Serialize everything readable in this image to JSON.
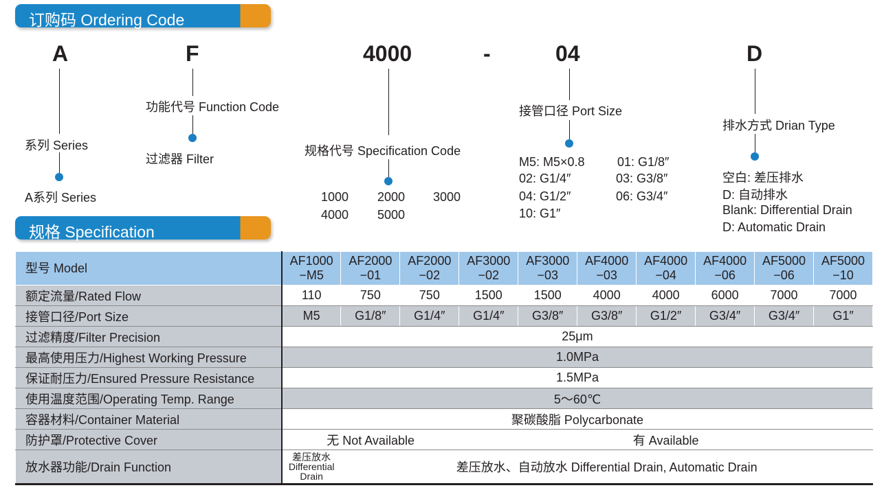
{
  "banners": {
    "ordering": "订购码 Ordering Code",
    "spec": "规格 Specification"
  },
  "code": {
    "letters": [
      "A",
      "F",
      "4000",
      "-",
      "04",
      "D"
    ],
    "series_label": "系列  Series",
    "series_value": "A系列 Series",
    "function_label": "功能代号 Function Code",
    "function_value": "过滤器   Filter",
    "spec_label": "规格代号 Specification Code",
    "spec_values": [
      "1000",
      "2000",
      "3000",
      "4000",
      "5000"
    ],
    "port_label": "接管口径 Port Size",
    "port_values": [
      "M5: M5×0.8",
      "01: G1/8″",
      "02: G1/4″",
      "03: G3/8″",
      "04: G1/2″",
      "06: G3/4″",
      "10: G1″"
    ],
    "drain_label": "排水方式 Drian Type",
    "drain_values": [
      "空白: 差压排水",
      "D: 自动排水",
      "Blank: Differential Drain",
      "D: Automatic Drain"
    ]
  },
  "table": {
    "model_header": "型号 Model",
    "models": [
      [
        "AF1000",
        "−M5"
      ],
      [
        "AF2000",
        "−01"
      ],
      [
        "AF2000",
        "−02"
      ],
      [
        "AF3000",
        "−02"
      ],
      [
        "AF3000",
        "−03"
      ],
      [
        "AF4000",
        "−03"
      ],
      [
        "AF4000",
        "−04"
      ],
      [
        "AF4000",
        "−06"
      ],
      [
        "AF5000",
        "−06"
      ],
      [
        "AF5000",
        "−10"
      ]
    ],
    "flow_header": "额定流量/Rated Flow",
    "flows": [
      "110",
      "750",
      "750",
      "1500",
      "1500",
      "4000",
      "4000",
      "6000",
      "7000",
      "7000"
    ],
    "port_header": "接管口径/Port Size",
    "ports": [
      "M5",
      "G1/8″",
      "G1/4″",
      "G1/4″",
      "G3/8″",
      "G3/8″",
      "G1/2″",
      "G3/4″",
      "G3/4″",
      "G1″"
    ],
    "precision_header": "过滤精度/Filter Precision",
    "precision": "25μm",
    "pressure_header": "最高使用压力/Highest Working Pressure",
    "pressure": "1.0MPa",
    "proof_header": "保证耐压力/Ensured Pressure Resistance",
    "proof": "1.5MPa",
    "temp_header": "使用温度范围/Operating Temp. Range",
    "temp": "5～60℃",
    "material_header": "容器材料/Container Material",
    "material": "聚碳酸脂  Polycarbonate",
    "cover_header": "防护罩/Protective Cover",
    "cover_no": "无  Not Available",
    "cover_yes": "有  Available",
    "drain_header": "放水器功能/Drain Function",
    "drain_first": [
      "差压放水",
      "Differential",
      "Drain"
    ],
    "drain_rest": "差压放水、自动放水  Differential Drain, Automatic Drain"
  }
}
